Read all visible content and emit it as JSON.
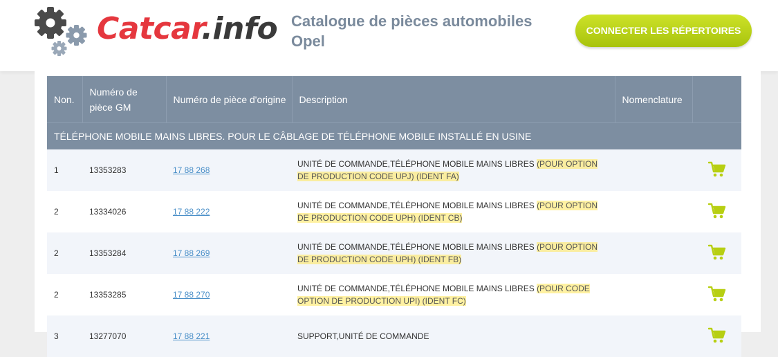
{
  "header": {
    "logo": {
      "red": "Catcar",
      "dark": ".info"
    },
    "title_line1": "Catalogue de pièces automobiles",
    "title_line2": "Opel",
    "connect_button": "CONNECTER LES RÉPERTOIRES"
  },
  "table": {
    "columns": {
      "num": "Non.",
      "gm": "Numéro de pièce GM",
      "orig": "Numéro de pièce d'origine",
      "desc": "Description",
      "nom": "Nomenclature"
    },
    "section_title": "TÉLÉPHONE MOBILE MAINS LIBRES. POUR LE CÂBLAGE DE TÉLÉPHONE MOBILE INSTALLÉ EN USINE",
    "rows": [
      {
        "num": "1",
        "gm": "13353283",
        "orig": "17 88 268",
        "desc_main": "UNITÉ DE COMMANDE,TÉLÉPHONE MOBILE MAINS LIBRES ",
        "desc_note": "(POUR OPTION DE PRODUCTION CODE UPJ) (IDENT FA)"
      },
      {
        "num": "2",
        "gm": "13334026",
        "orig": "17 88 222",
        "desc_main": "UNITÉ DE COMMANDE,TÉLÉPHONE MOBILE MAINS LIBRES ",
        "desc_note": "(POUR OPTION DE PRODUCTION CODE UPH) (IDENT CB)"
      },
      {
        "num": "2",
        "gm": "13353284",
        "orig": "17 88 269",
        "desc_main": "UNITÉ DE COMMANDE,TÉLÉPHONE MOBILE MAINS LIBRES ",
        "desc_note": "(POUR OPTION DE PRODUCTION CODE UPH) (IDENT FB)"
      },
      {
        "num": "2",
        "gm": "13353285",
        "orig": "17 88 270",
        "desc_main": "UNITÉ DE COMMANDE,TÉLÉPHONE MOBILE MAINS LIBRES ",
        "desc_note": "(POUR CODE OPTION DE PRODUCTION UPI) (IDENT FC)"
      },
      {
        "num": "3",
        "gm": "13277070",
        "orig": "17 88 221",
        "desc_main": "SUPPORT,UNITÉ DE COMMANDE",
        "desc_note": ""
      }
    ]
  },
  "icons": {
    "cart": "shopping-cart-icon",
    "gear": "gear-icon"
  },
  "colors": {
    "header_bg": "#7d8ea1",
    "accent_green": "#b7cf12",
    "logo_red": "#e5373e",
    "link_blue": "#4a8fc8",
    "highlight_yellow": "#ffe864"
  }
}
